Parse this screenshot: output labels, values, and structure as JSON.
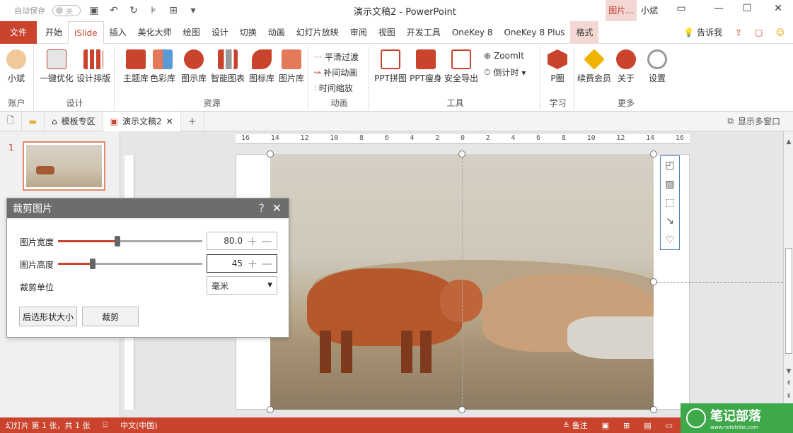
{
  "titlebar": {
    "autosave_label": "自动保存",
    "autosave_state": "关",
    "title": "演示文稿2 - PowerPoint",
    "context_tab": "图片...",
    "user": "小斌"
  },
  "tabs": {
    "file": "文件",
    "items": [
      "开始",
      "iSlide",
      "插入",
      "美化大师",
      "绘图",
      "设计",
      "切换",
      "动画",
      "幻灯片放映",
      "审阅",
      "视图",
      "开发工具",
      "OneKey 8",
      "OneKey 8 Plus",
      "格式"
    ],
    "tell_me": "告诉我"
  },
  "ribbon": {
    "account": {
      "user": "小斌",
      "label": "账户"
    },
    "design": {
      "buttons": [
        "一键优化",
        "设计排版"
      ],
      "label": "设计"
    },
    "resources": {
      "buttons": [
        "主题库",
        "色彩库",
        "图示库",
        "智能图表",
        "图标库",
        "图片库"
      ],
      "label": "资源"
    },
    "animation": {
      "items": [
        "平滑过渡",
        "补间动画",
        "时间缩放"
      ],
      "label": "动画"
    },
    "tools": {
      "buttons": [
        "PPT拼图",
        "PPT瘦身",
        "安全导出"
      ],
      "side": [
        "ZoomIt",
        "倒计时"
      ],
      "label": "工具"
    },
    "study": {
      "button": "P圈",
      "label": "学习"
    },
    "more": {
      "buttons": [
        "续费会员",
        "关于",
        "设置"
      ],
      "label": "更多"
    }
  },
  "doctabs": {
    "template": "模板专区",
    "doc": "演示文稿2",
    "multiwindow": "显示多窗口"
  },
  "slide_panel": {
    "number": "1"
  },
  "ruler": {
    "ticks": [
      "16",
      "14",
      "12",
      "10",
      "8",
      "6",
      "4",
      "2",
      "0",
      "2",
      "4",
      "6",
      "8",
      "10",
      "12",
      "14",
      "16"
    ]
  },
  "dialog": {
    "title": "裁剪图片",
    "help": "?",
    "width_label": "图片宽度",
    "width_value": "80.0",
    "width_fraction": 0.41,
    "height_label": "图片高度",
    "height_value": "45",
    "height_fraction": 0.24,
    "unit_label": "裁剪单位",
    "unit_value": "毫米",
    "btn_shape": "后选形状大小",
    "btn_crop": "裁剪"
  },
  "status": {
    "slide_info": "幻灯片 第 1 张，共 1 张",
    "language": "中文(中国)",
    "notes": "备注"
  },
  "watermark": {
    "text": "笔记部落",
    "sub": "www.notetribe.com"
  },
  "colors": {
    "accent": "#c9432d",
    "dialog_header": "#6d6d6d",
    "watermark": "#3ea84b"
  }
}
